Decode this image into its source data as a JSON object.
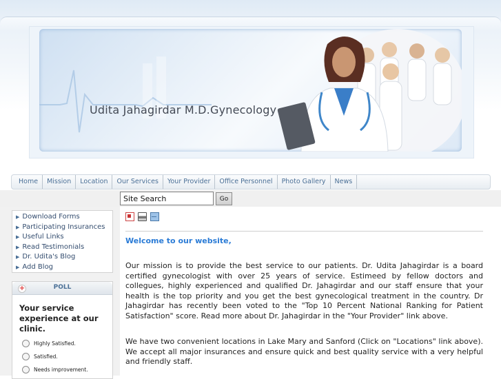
{
  "header": {
    "site_title": "Udita Jahagirdar M.D.Gynecology"
  },
  "nav": {
    "items": [
      "Home",
      "Mission",
      "Location",
      "Our Services",
      "Your Provider",
      "Office Personnel",
      "Photo Gallery",
      "News"
    ]
  },
  "search": {
    "value": "Site Search",
    "button_label": "Go"
  },
  "sidebar": {
    "items": [
      "Download Forms",
      "Participating Insurances",
      "Useful Links",
      "Read Testimonials",
      "Dr. Udita's Blog",
      "Add Blog"
    ]
  },
  "poll": {
    "title": "POLL",
    "question": "Your service experience at our clinic.",
    "options": [
      "Highly Satisfied.",
      "Satisfied.",
      "Needs improvement."
    ]
  },
  "content": {
    "welcome": "Welcome to our website,",
    "paragraph1": "Our mission is to provide the best service to our patients. Dr. Udita Jahagirdar is a board certified gynecologist with over 25 years of service. Estimeed by fellow doctors and collegues, highly experienced and qualified Dr. Jahagirdar and our staff ensure that your health is the top priority and you get the best gynecological treatment in the country. Dr Jahagirdar has recently been voted to the \"Top 10 Percent National Ranking for Patient Satisfaction\" score.  Read more about Dr. Jahagirdar in the \"Your Provider\" link above.",
    "paragraph2": "We have two convenient locations in Lake Mary and Sanford (Click on \"Locations\" link above). We accept all major insurances and ensure quick and best quality service with a very helpful and friendly staff."
  },
  "icons": {
    "pdf": "pdf-icon",
    "print": "print-icon",
    "email": "email-icon"
  },
  "colors": {
    "link": "#4a6f96",
    "welcome": "#2a7bd6"
  }
}
